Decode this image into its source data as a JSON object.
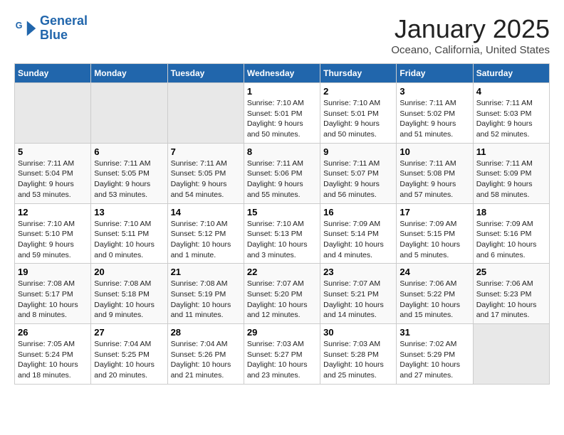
{
  "header": {
    "logo_line1": "General",
    "logo_line2": "Blue",
    "month": "January 2025",
    "location": "Oceano, California, United States"
  },
  "days_of_week": [
    "Sunday",
    "Monday",
    "Tuesday",
    "Wednesday",
    "Thursday",
    "Friday",
    "Saturday"
  ],
  "weeks": [
    [
      {
        "day": "",
        "info": ""
      },
      {
        "day": "",
        "info": ""
      },
      {
        "day": "",
        "info": ""
      },
      {
        "day": "1",
        "info": "Sunrise: 7:10 AM\nSunset: 5:01 PM\nDaylight: 9 hours\nand 50 minutes."
      },
      {
        "day": "2",
        "info": "Sunrise: 7:10 AM\nSunset: 5:01 PM\nDaylight: 9 hours\nand 50 minutes."
      },
      {
        "day": "3",
        "info": "Sunrise: 7:11 AM\nSunset: 5:02 PM\nDaylight: 9 hours\nand 51 minutes."
      },
      {
        "day": "4",
        "info": "Sunrise: 7:11 AM\nSunset: 5:03 PM\nDaylight: 9 hours\nand 52 minutes."
      }
    ],
    [
      {
        "day": "5",
        "info": "Sunrise: 7:11 AM\nSunset: 5:04 PM\nDaylight: 9 hours\nand 53 minutes."
      },
      {
        "day": "6",
        "info": "Sunrise: 7:11 AM\nSunset: 5:05 PM\nDaylight: 9 hours\nand 53 minutes."
      },
      {
        "day": "7",
        "info": "Sunrise: 7:11 AM\nSunset: 5:05 PM\nDaylight: 9 hours\nand 54 minutes."
      },
      {
        "day": "8",
        "info": "Sunrise: 7:11 AM\nSunset: 5:06 PM\nDaylight: 9 hours\nand 55 minutes."
      },
      {
        "day": "9",
        "info": "Sunrise: 7:11 AM\nSunset: 5:07 PM\nDaylight: 9 hours\nand 56 minutes."
      },
      {
        "day": "10",
        "info": "Sunrise: 7:11 AM\nSunset: 5:08 PM\nDaylight: 9 hours\nand 57 minutes."
      },
      {
        "day": "11",
        "info": "Sunrise: 7:11 AM\nSunset: 5:09 PM\nDaylight: 9 hours\nand 58 minutes."
      }
    ],
    [
      {
        "day": "12",
        "info": "Sunrise: 7:10 AM\nSunset: 5:10 PM\nDaylight: 9 hours\nand 59 minutes."
      },
      {
        "day": "13",
        "info": "Sunrise: 7:10 AM\nSunset: 5:11 PM\nDaylight: 10 hours\nand 0 minutes."
      },
      {
        "day": "14",
        "info": "Sunrise: 7:10 AM\nSunset: 5:12 PM\nDaylight: 10 hours\nand 1 minute."
      },
      {
        "day": "15",
        "info": "Sunrise: 7:10 AM\nSunset: 5:13 PM\nDaylight: 10 hours\nand 3 minutes."
      },
      {
        "day": "16",
        "info": "Sunrise: 7:09 AM\nSunset: 5:14 PM\nDaylight: 10 hours\nand 4 minutes."
      },
      {
        "day": "17",
        "info": "Sunrise: 7:09 AM\nSunset: 5:15 PM\nDaylight: 10 hours\nand 5 minutes."
      },
      {
        "day": "18",
        "info": "Sunrise: 7:09 AM\nSunset: 5:16 PM\nDaylight: 10 hours\nand 6 minutes."
      }
    ],
    [
      {
        "day": "19",
        "info": "Sunrise: 7:08 AM\nSunset: 5:17 PM\nDaylight: 10 hours\nand 8 minutes."
      },
      {
        "day": "20",
        "info": "Sunrise: 7:08 AM\nSunset: 5:18 PM\nDaylight: 10 hours\nand 9 minutes."
      },
      {
        "day": "21",
        "info": "Sunrise: 7:08 AM\nSunset: 5:19 PM\nDaylight: 10 hours\nand 11 minutes."
      },
      {
        "day": "22",
        "info": "Sunrise: 7:07 AM\nSunset: 5:20 PM\nDaylight: 10 hours\nand 12 minutes."
      },
      {
        "day": "23",
        "info": "Sunrise: 7:07 AM\nSunset: 5:21 PM\nDaylight: 10 hours\nand 14 minutes."
      },
      {
        "day": "24",
        "info": "Sunrise: 7:06 AM\nSunset: 5:22 PM\nDaylight: 10 hours\nand 15 minutes."
      },
      {
        "day": "25",
        "info": "Sunrise: 7:06 AM\nSunset: 5:23 PM\nDaylight: 10 hours\nand 17 minutes."
      }
    ],
    [
      {
        "day": "26",
        "info": "Sunrise: 7:05 AM\nSunset: 5:24 PM\nDaylight: 10 hours\nand 18 minutes."
      },
      {
        "day": "27",
        "info": "Sunrise: 7:04 AM\nSunset: 5:25 PM\nDaylight: 10 hours\nand 20 minutes."
      },
      {
        "day": "28",
        "info": "Sunrise: 7:04 AM\nSunset: 5:26 PM\nDaylight: 10 hours\nand 21 minutes."
      },
      {
        "day": "29",
        "info": "Sunrise: 7:03 AM\nSunset: 5:27 PM\nDaylight: 10 hours\nand 23 minutes."
      },
      {
        "day": "30",
        "info": "Sunrise: 7:03 AM\nSunset: 5:28 PM\nDaylight: 10 hours\nand 25 minutes."
      },
      {
        "day": "31",
        "info": "Sunrise: 7:02 AM\nSunset: 5:29 PM\nDaylight: 10 hours\nand 27 minutes."
      },
      {
        "day": "",
        "info": ""
      }
    ]
  ]
}
